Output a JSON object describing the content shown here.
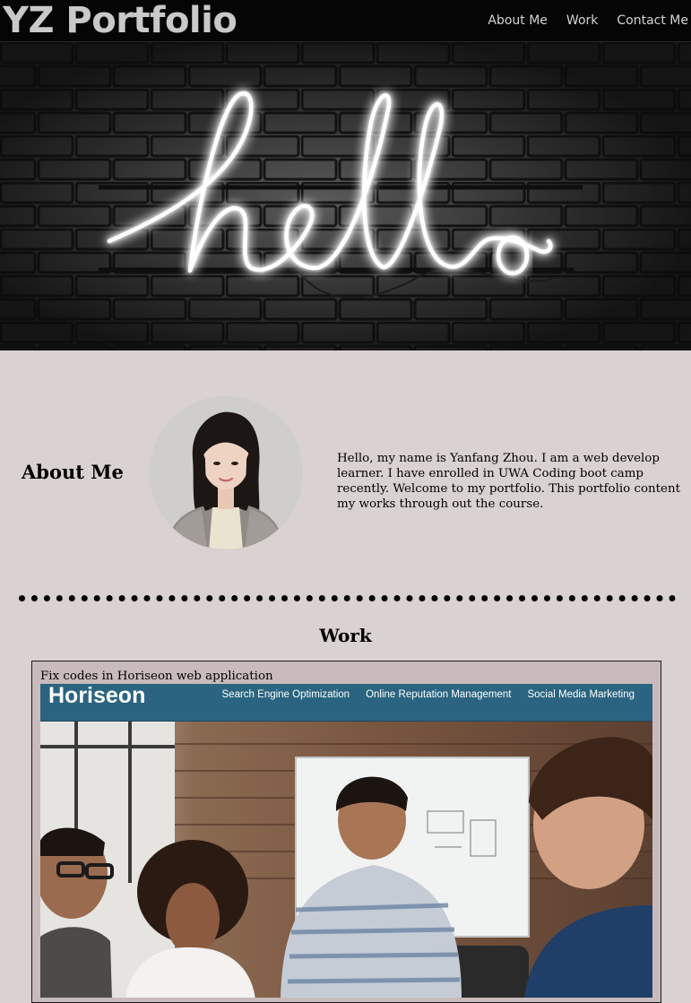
{
  "header": {
    "brand": "YZ Portfolio",
    "nav": [
      "About Me",
      "Work",
      "Contact Me"
    ]
  },
  "hero": {
    "sign_text": "hello"
  },
  "about": {
    "heading": "About Me",
    "bio": "Hello, my name is Yanfang Zhou. I am a web develop learner. I have enrolled in UWA Coding boot camp recently. Welcome to my portfolio. This portfolio content my works through out the course."
  },
  "work": {
    "heading": "Work",
    "projects": [
      {
        "title": "Fix codes in Horiseon web application",
        "screenshot": {
          "logo": "Horiseon",
          "nav": [
            "Search Engine Optimization",
            "Online Reputation Management",
            "Social Media Marketing"
          ]
        }
      }
    ]
  },
  "colors": {
    "page_background": "#dad1d1",
    "topbar_background": "#050505",
    "card_background": "#c9bbbb",
    "horiseon_header": "#2a6480"
  }
}
